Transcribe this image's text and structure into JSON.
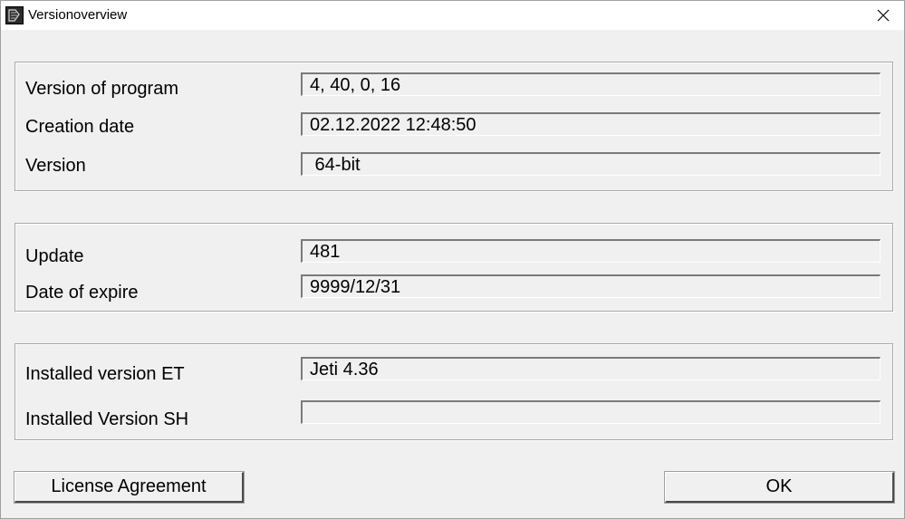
{
  "window": {
    "title": "Versionoverview",
    "icon": "app-logo-icon",
    "close_icon": "close-icon"
  },
  "program_group": {
    "rows": [
      {
        "label": "Version of program",
        "value": "4, 40, 0, 16"
      },
      {
        "label": "Creation date",
        "value": "02.12.2022 12:48:50"
      },
      {
        "label": "Version",
        "value": " 64-bit"
      }
    ]
  },
  "update_group": {
    "rows": [
      {
        "label": "Update",
        "value": "481"
      },
      {
        "label": "Date of expire",
        "value": "9999/12/31"
      }
    ]
  },
  "installed_group": {
    "rows": [
      {
        "label": "Installed version ET",
        "value": "Jeti 4.36"
      },
      {
        "label": "Installed Version SH",
        "value": ""
      }
    ]
  },
  "buttons": {
    "license": "License Agreement",
    "ok": "OK"
  }
}
